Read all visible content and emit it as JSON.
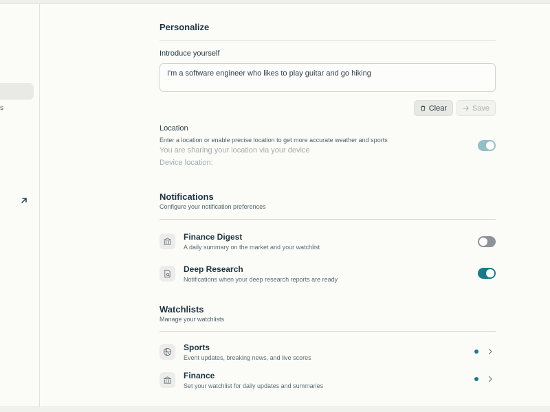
{
  "sidebar": {
    "fragment_label": "s"
  },
  "personalize": {
    "title": "Personalize",
    "intro_label": "Introduce yourself",
    "intro_value": "I'm a software engineer who likes to play guitar and go hiking",
    "clear_label": "Clear",
    "save_label": "Save"
  },
  "location": {
    "title": "Location",
    "description": "Enter a location or enable precise location to get more accurate weather and sports",
    "sharing_text": "You are sharing your location via your device",
    "device_location_label": "Device location:",
    "toggle_on": true
  },
  "notifications": {
    "title": "Notifications",
    "subtitle": "Configure your notification preferences",
    "items": [
      {
        "title": "Finance Digest",
        "description": "A daily summary on the market and your watchlist",
        "icon": "bank-icon",
        "enabled": false
      },
      {
        "title": "Deep Research",
        "description": "Notifications when your deep research reports are ready",
        "icon": "research-icon",
        "enabled": true
      }
    ]
  },
  "watchlists": {
    "title": "Watchlists",
    "subtitle": "Manage your watchlists",
    "items": [
      {
        "title": "Sports",
        "description": "Event updates, breaking news, and live scores",
        "icon": "basketball-icon"
      },
      {
        "title": "Finance",
        "description": "Set your watchlist for daily updates and summaries",
        "icon": "bank-icon"
      }
    ]
  },
  "colors": {
    "accent": "#1b7a8a",
    "background": "#fbfbf8",
    "text": "#1e3440"
  }
}
